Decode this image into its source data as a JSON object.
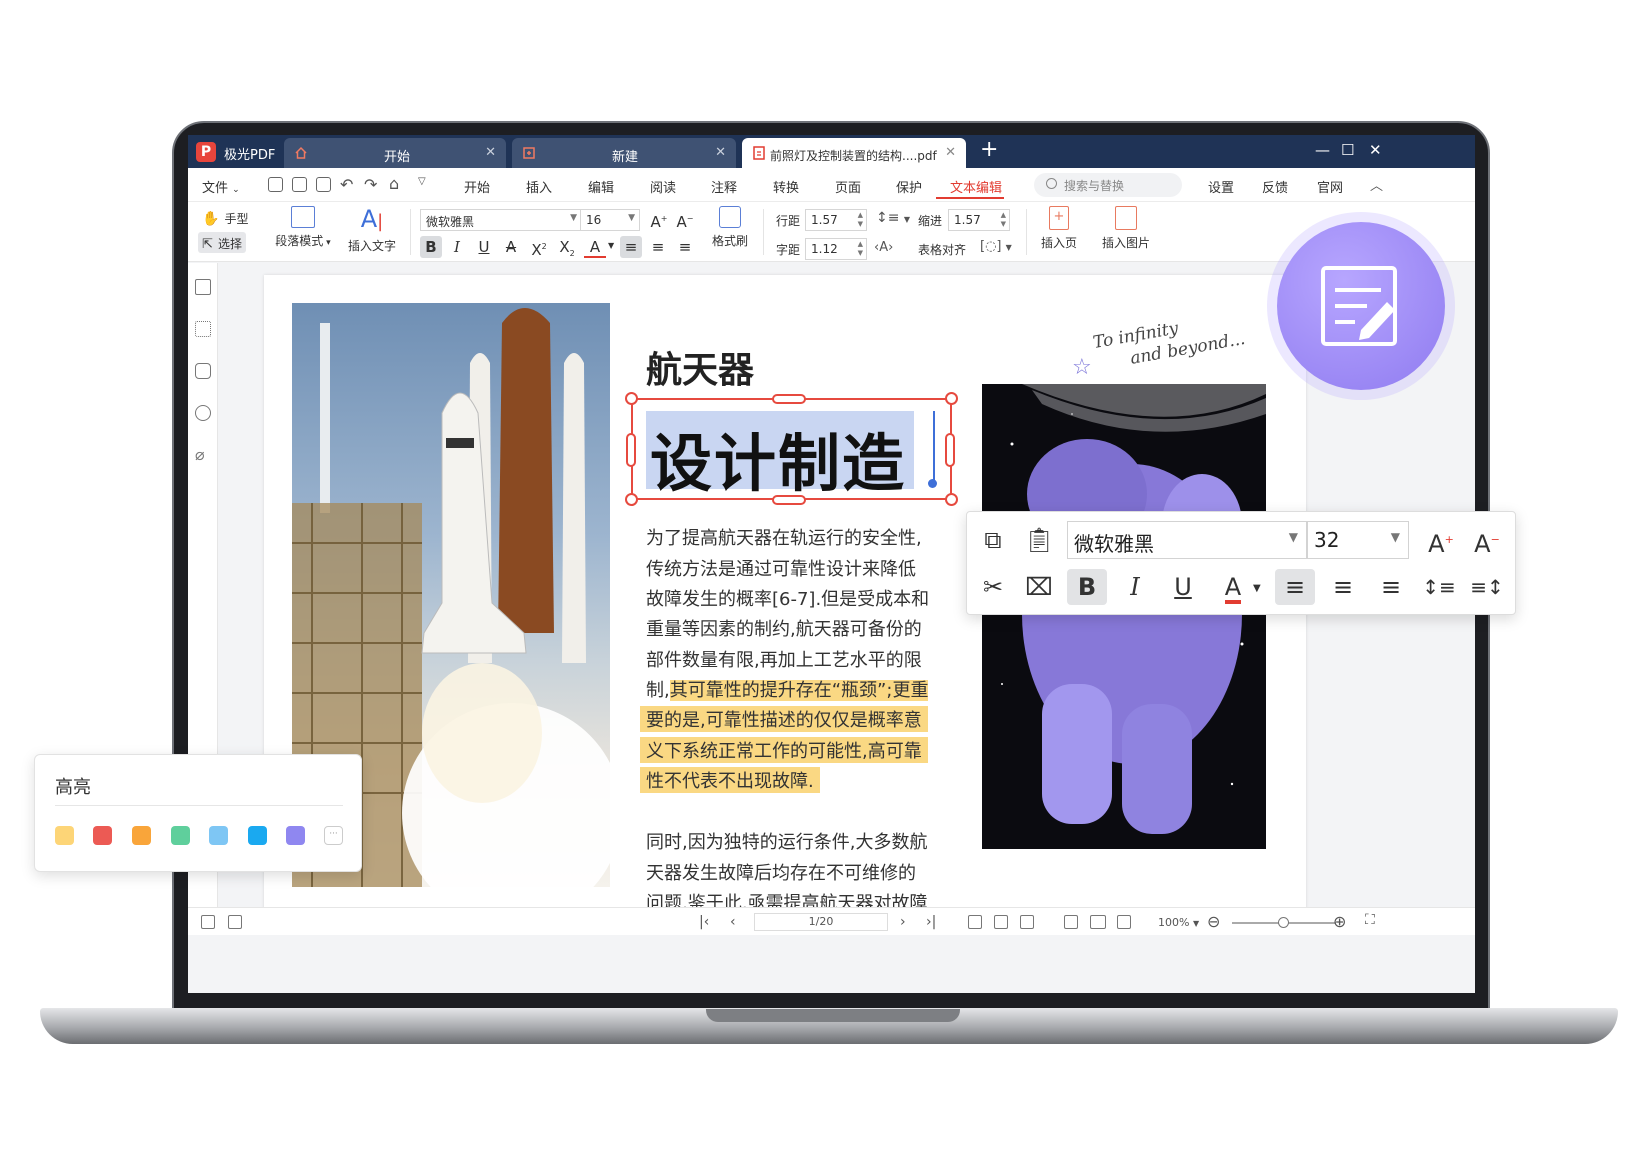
{
  "app": {
    "name": "极光PDF",
    "logo_letter": "P"
  },
  "tabs": [
    {
      "label": "开始",
      "active": false
    },
    {
      "label": "新建",
      "active": false
    },
    {
      "label": "前照灯及控制装置的结构....pdf",
      "active": true
    }
  ],
  "window_controls": {
    "minimize": "—",
    "maximize": "☐",
    "close": "✕"
  },
  "menu": {
    "file": "文件",
    "items": [
      "开始",
      "插入",
      "编辑",
      "阅读",
      "注释",
      "转换",
      "页面",
      "保护",
      "文本编辑"
    ],
    "active_item": "文本编辑",
    "search_placeholder": "搜索与替换",
    "right_items": [
      "设置",
      "反馈",
      "官网"
    ]
  },
  "ribbon": {
    "hand_tool": "手型",
    "select_tool": "选择",
    "paragraph_mode": "段落模式",
    "insert_text": "插入文字",
    "font_name": "微软雅黑",
    "font_size": "16",
    "format_painter": "格式刷",
    "line_spacing_label": "行距",
    "line_spacing": "1.57",
    "indent_label": "缩进",
    "indent": "1.57",
    "char_spacing_label": "字距",
    "char_spacing": "1.12",
    "table_align": "表格对齐",
    "insert_page": "插入页",
    "insert_image": "插入图片"
  },
  "document": {
    "heading_small": "航天器",
    "heading_large": "设计制造",
    "paragraph1": [
      {
        "text": "为了提高航天器在轨运行的安全性,",
        "hl": false
      },
      {
        "text": "传统方法是通过可靠性设计来降低",
        "hl": false
      },
      {
        "text": "故障发生的概率[6-7].但是受成本和",
        "hl": false
      },
      {
        "text": "重量等因素的制约,航天器可备份的",
        "hl": false
      },
      {
        "text": "部件数量有限,再加上工艺水平的限",
        "hl": false
      },
      {
        "pre": "制,",
        "text": "其可靠性的提升存在“瓶颈”;更重",
        "hl": true
      },
      {
        "text": "要的是,可靠性描述的仅仅是概率意",
        "hl": true
      },
      {
        "text": "义下系统正常工作的可能性,高可靠",
        "hl": true
      },
      {
        "text": "性不代表不出现故障.",
        "hl": true
      }
    ],
    "paragraph2": [
      "同时,因为独特的运行条件,大多数航",
      "天器发生故障后均存在不可维修的",
      "问题,鉴于此,亟需提高航天器对故障"
    ],
    "handwriting_line1": "To infinity",
    "handwriting_line2": "and beyond..."
  },
  "format_toolbar": {
    "font_name": "微软雅黑",
    "font_size": "32"
  },
  "highlight_panel": {
    "title": "高亮",
    "colors": [
      "#fdd577",
      "#ec5a54",
      "#f9a53a",
      "#5fcf9c",
      "#7ec6f4",
      "#1aa9f0",
      "#8f87f0"
    ],
    "more": "···"
  },
  "statusbar": {
    "page": "1/20",
    "zoom": "100%"
  },
  "accent_color": "#e23c31"
}
